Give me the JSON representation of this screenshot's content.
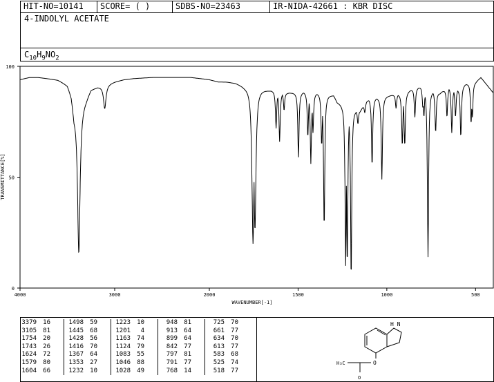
{
  "header": {
    "hit_no": "HIT-NO=10141",
    "score": "SCORE=  (  )",
    "sdbs_no": "SDBS-NO=23463",
    "ir_nida": "IR-NIDA-42661 : KBR DISC"
  },
  "compound": {
    "name": "4-INDOLYL ACETATE",
    "formula_parts": [
      "C",
      "10",
      "H",
      "9",
      "N",
      "O",
      "2"
    ]
  },
  "structure_labels": {
    "nh": "H N",
    "methyl": "H₃C",
    "oxygen": "O",
    "carbonyl_o": "O"
  },
  "chart_data": {
    "type": "line",
    "xlabel": "WAVENUMBER[-1]",
    "ylabel": "TRANSMITTANCE[%]",
    "xlim": [
      4000,
      400
    ],
    "ylim": [
      0,
      100
    ],
    "x_ticks": [
      4000,
      3000,
      2000,
      1500,
      1000,
      500
    ],
    "x_tick_labels": [
      "4000",
      "3000",
      "2000",
      "1500",
      "1000",
      "500"
    ],
    "y_ticks": [
      0,
      50,
      100
    ],
    "y_tick_labels": [
      "0",
      "50",
      "100"
    ],
    "baseline_points": [
      [
        4000,
        94
      ],
      [
        3900,
        95
      ],
      [
        3800,
        95
      ],
      [
        3700,
        94.5
      ],
      [
        3600,
        94
      ],
      [
        3500,
        92
      ],
      [
        3460,
        88
      ],
      [
        3430,
        80
      ],
      [
        3300,
        86
      ],
      [
        3250,
        90
      ],
      [
        3150,
        91
      ],
      [
        3000,
        93
      ],
      [
        2900,
        94
      ],
      [
        2800,
        94.5
      ],
      [
        2600,
        95
      ],
      [
        2400,
        95
      ],
      [
        2200,
        95
      ],
      [
        2100,
        94.5
      ],
      [
        2000,
        94
      ],
      [
        1950,
        93
      ],
      [
        1900,
        93
      ],
      [
        1850,
        92.5
      ],
      [
        1800,
        91
      ],
      [
        1560,
        88
      ],
      [
        1470,
        88.5
      ],
      [
        1300,
        87
      ],
      [
        1280,
        84
      ],
      [
        1150,
        80
      ],
      [
        1100,
        86
      ],
      [
        1050,
        86
      ],
      [
        900,
        88
      ],
      [
        850,
        90
      ],
      [
        800,
        91
      ],
      [
        700,
        88
      ],
      [
        650,
        91
      ],
      [
        600,
        90
      ],
      [
        560,
        92
      ],
      [
        500,
        93
      ],
      [
        470,
        95
      ],
      [
        440,
        92
      ],
      [
        420,
        90
      ],
      [
        400,
        88
      ]
    ],
    "peaks": [
      {
        "x": 3379,
        "y": 16
      },
      {
        "x": 3105,
        "y": 81
      },
      {
        "x": 1754,
        "y": 20
      },
      {
        "x": 1743,
        "y": 26
      },
      {
        "x": 1624,
        "y": 72
      },
      {
        "x": 1579,
        "y": 80
      },
      {
        "x": 1604,
        "y": 66
      },
      {
        "x": 1498,
        "y": 59
      },
      {
        "x": 1445,
        "y": 68
      },
      {
        "x": 1428,
        "y": 56
      },
      {
        "x": 1416,
        "y": 70
      },
      {
        "x": 1367,
        "y": 64
      },
      {
        "x": 1353,
        "y": 27
      },
      {
        "x": 1232,
        "y": 10
      },
      {
        "x": 1223,
        "y": 10
      },
      {
        "x": 1201,
        "y": 4
      },
      {
        "x": 1163,
        "y": 74
      },
      {
        "x": 1124,
        "y": 79
      },
      {
        "x": 1083,
        "y": 55
      },
      {
        "x": 1046,
        "y": 88
      },
      {
        "x": 1028,
        "y": 49
      },
      {
        "x": 948,
        "y": 81
      },
      {
        "x": 913,
        "y": 64
      },
      {
        "x": 899,
        "y": 64
      },
      {
        "x": 842,
        "y": 77
      },
      {
        "x": 797,
        "y": 81
      },
      {
        "x": 791,
        "y": 77
      },
      {
        "x": 768,
        "y": 14
      },
      {
        "x": 725,
        "y": 70
      },
      {
        "x": 661,
        "y": 77
      },
      {
        "x": 634,
        "y": 70
      },
      {
        "x": 613,
        "y": 77
      },
      {
        "x": 583,
        "y": 68
      },
      {
        "x": 525,
        "y": 74
      },
      {
        "x": 518,
        "y": 77
      }
    ]
  },
  "peak_table": {
    "columns": [
      [
        [
          "3379",
          "16"
        ],
        [
          "3105",
          "81"
        ],
        [
          "1754",
          "20"
        ],
        [
          "1743",
          "26"
        ],
        [
          "1624",
          "72"
        ],
        [
          "1579",
          "80"
        ],
        [
          "1604",
          "66"
        ]
      ],
      [
        [
          "1498",
          "59"
        ],
        [
          "1445",
          "68"
        ],
        [
          "1428",
          "56"
        ],
        [
          "1416",
          "70"
        ],
        [
          "1367",
          "64"
        ],
        [
          "1353",
          "27"
        ],
        [
          "1232",
          "10"
        ]
      ],
      [
        [
          "1223",
          "10"
        ],
        [
          "1201",
          "4"
        ],
        [
          "1163",
          "74"
        ],
        [
          "1124",
          "79"
        ],
        [
          "1083",
          "55"
        ],
        [
          "1046",
          "88"
        ],
        [
          "1028",
          "49"
        ]
      ],
      [
        [
          "948",
          "81"
        ],
        [
          "913",
          "64"
        ],
        [
          "899",
          "64"
        ],
        [
          "842",
          "77"
        ],
        [
          "797",
          "81"
        ],
        [
          "791",
          "77"
        ],
        [
          "768",
          "14"
        ]
      ],
      [
        [
          "725",
          "70"
        ],
        [
          "661",
          "77"
        ],
        [
          "634",
          "70"
        ],
        [
          "613",
          "77"
        ],
        [
          "583",
          "68"
        ],
        [
          "525",
          "74"
        ],
        [
          "518",
          "77"
        ]
      ]
    ]
  }
}
